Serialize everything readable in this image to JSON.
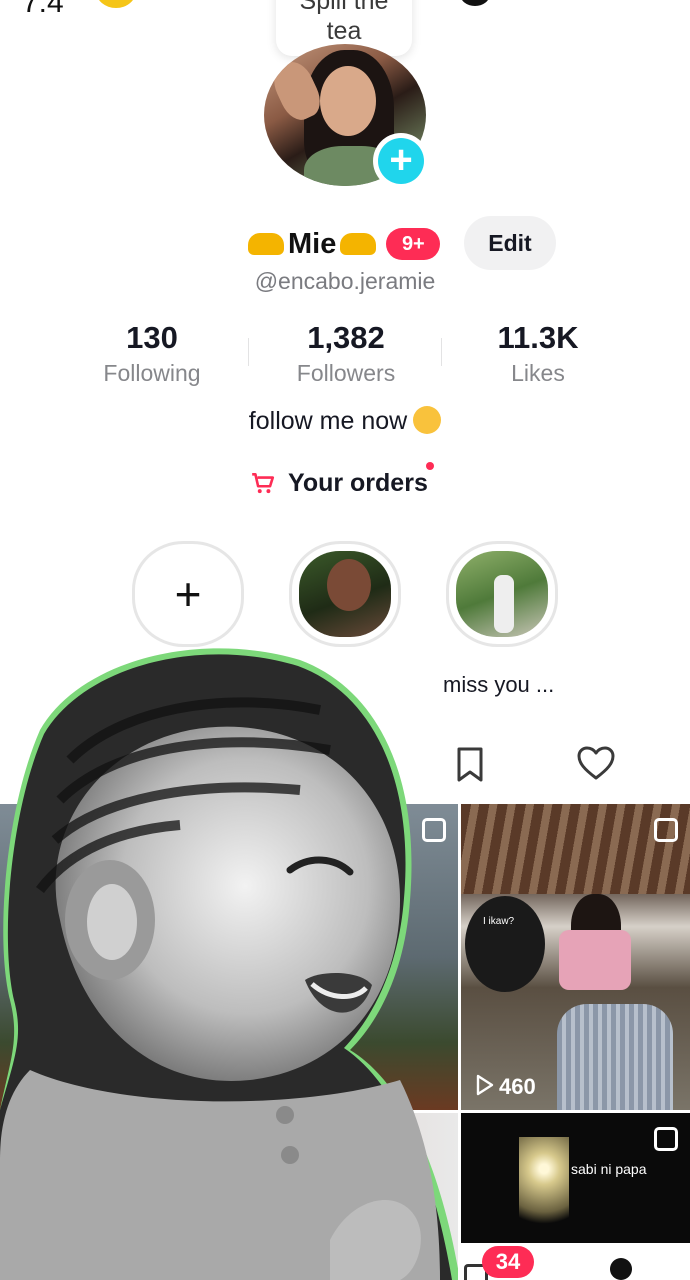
{
  "status_bar": {
    "time_fragment": "7:4"
  },
  "note_bubble": {
    "line1": "Spill the",
    "line2": "tea"
  },
  "profile": {
    "display_name": "Mie",
    "notification_badge": "9+",
    "edit_label": "Edit",
    "username": "@encabo.jeramie",
    "bio": "follow me now"
  },
  "stats": [
    {
      "value": "130",
      "label": "Following"
    },
    {
      "value": "1,382",
      "label": "Followers"
    },
    {
      "value": "11.3K",
      "label": "Likes"
    }
  ],
  "orders": {
    "label": "Your orders"
  },
  "highlights": [
    {
      "label": "+"
    },
    {
      "label": ""
    },
    {
      "label": "miss you ..."
    }
  ],
  "grid": {
    "tile_b_views": "460",
    "tile_b_snippet": "I ikaw?",
    "tile_d_caption": "sabi ni papa"
  },
  "bottom_nav": {
    "inbox_badge": "34"
  },
  "colors": {
    "accent": "#fe2c55",
    "plus_blue": "#20d5ec",
    "text": "#161823",
    "muted": "#86878b"
  }
}
